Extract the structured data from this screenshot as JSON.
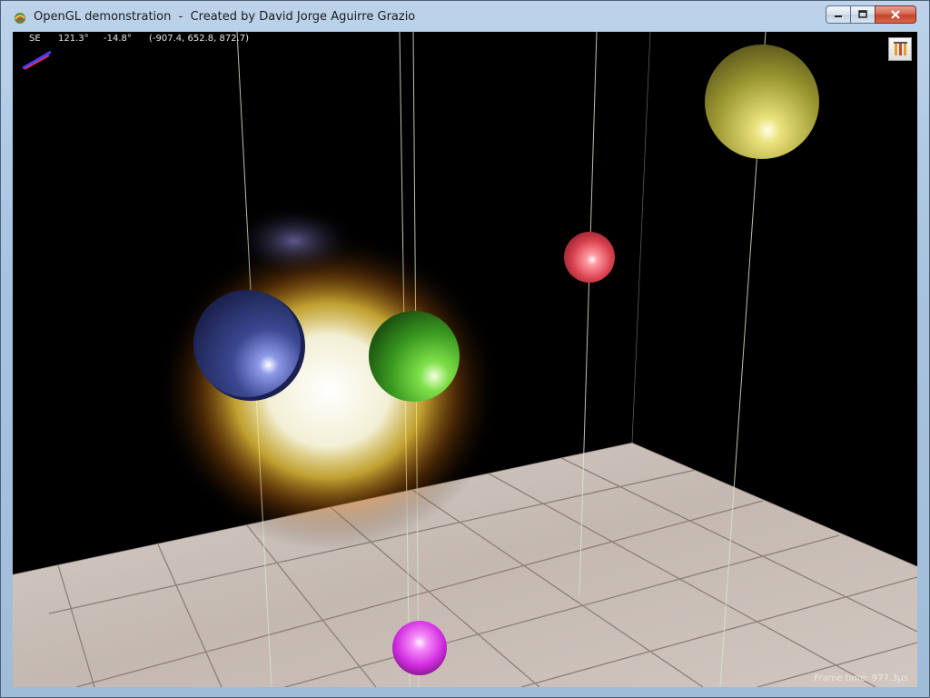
{
  "window": {
    "title": "OpenGL demonstration  -  Created by David Jorge Aguirre Grazio",
    "icon": "app-icon",
    "controls": {
      "minimize": "minimize-icon",
      "maximize": "maximize-icon",
      "close": "close-icon"
    }
  },
  "hud": {
    "direction": "SE",
    "yaw": "121.3°",
    "pitch": "-14.8°",
    "position": "(-907.4, 652.8, 872.7)",
    "frame_time": "Frame time: 977.3µs"
  },
  "toolbar": {
    "options_icon": "pencils-icon"
  },
  "scene": {
    "spheres": [
      {
        "name": "blue-sphere",
        "color": "#3a4a9c"
      },
      {
        "name": "green-sphere",
        "color": "#3fae2a"
      },
      {
        "name": "red-sphere",
        "color": "#e0485a"
      },
      {
        "name": "yellow-sphere",
        "color": "#b8b040"
      },
      {
        "name": "magenta-sphere",
        "color": "#e23ff0"
      }
    ],
    "floor_color": "#c9bdb6",
    "background_color": "#000000"
  }
}
